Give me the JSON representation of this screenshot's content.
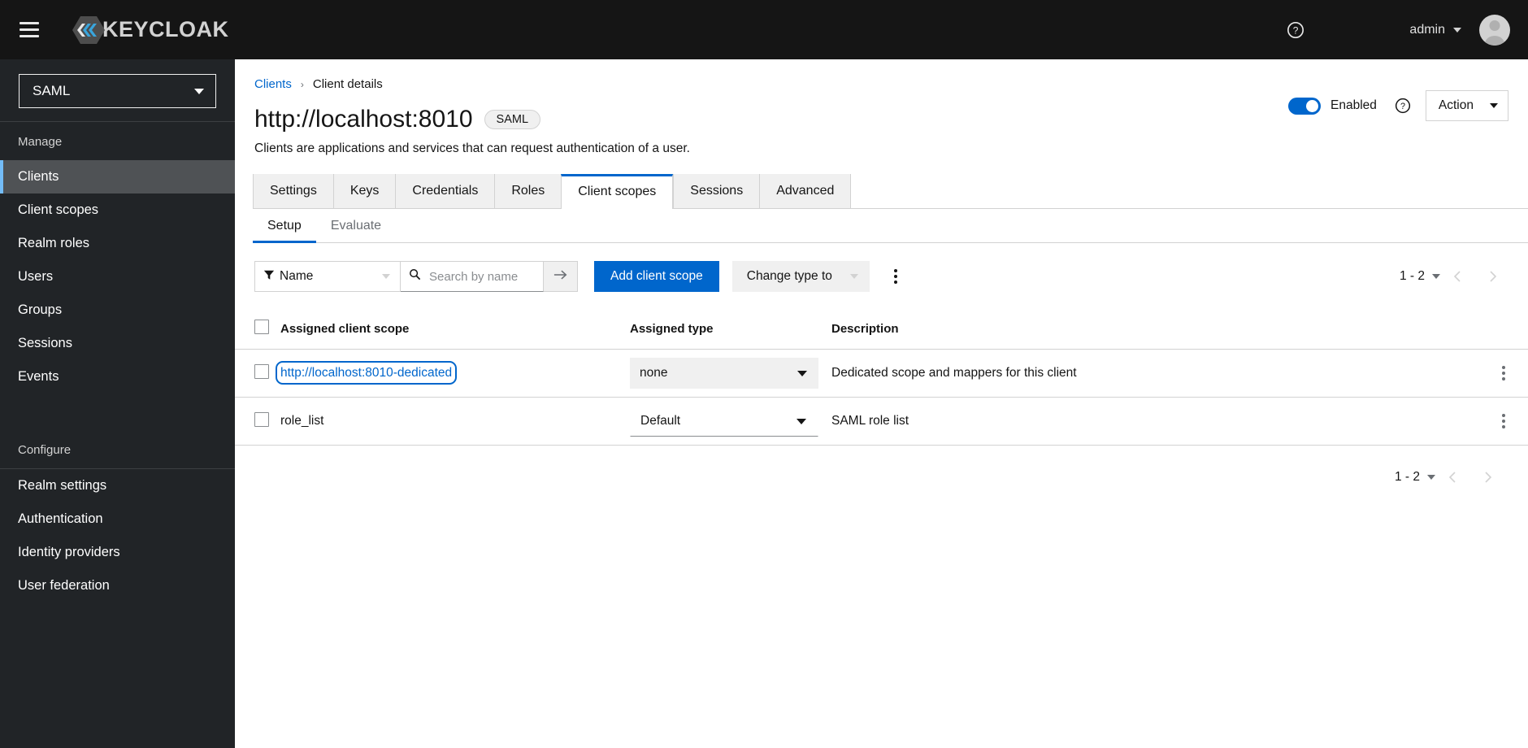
{
  "masthead": {
    "menu_icon": "hamburger-icon",
    "brand": "KEYCLOAK",
    "help_icon": "help-circle-icon",
    "username": "admin",
    "avatar_icon": "user-avatar-icon"
  },
  "sidebar": {
    "realm_selected": "SAML",
    "groups": [
      {
        "title": "Manage",
        "items": [
          {
            "label": "Clients",
            "active": true
          },
          {
            "label": "Client scopes",
            "active": false
          },
          {
            "label": "Realm roles",
            "active": false
          },
          {
            "label": "Users",
            "active": false
          },
          {
            "label": "Groups",
            "active": false
          },
          {
            "label": "Sessions",
            "active": false
          },
          {
            "label": "Events",
            "active": false
          }
        ]
      },
      {
        "title": "Configure",
        "items": [
          {
            "label": "Realm settings",
            "active": false
          },
          {
            "label": "Authentication",
            "active": false
          },
          {
            "label": "Identity providers",
            "active": false
          },
          {
            "label": "User federation",
            "active": false
          }
        ]
      }
    ]
  },
  "breadcrumb": {
    "parent": "Clients",
    "separator": "›",
    "current": "Client details"
  },
  "header": {
    "title": "http://localhost:8010",
    "badge": "SAML",
    "description": "Clients are applications and services that can request authentication of a user.",
    "enabled_label": "Enabled",
    "enabled_state": true,
    "help_icon": "help-circle-icon",
    "action_label": "Action"
  },
  "tabs": [
    {
      "label": "Settings",
      "active": false
    },
    {
      "label": "Keys",
      "active": false
    },
    {
      "label": "Credentials",
      "active": false
    },
    {
      "label": "Roles",
      "active": false
    },
    {
      "label": "Client scopes",
      "active": true
    },
    {
      "label": "Sessions",
      "active": false
    },
    {
      "label": "Advanced",
      "active": false
    }
  ],
  "subtabs": [
    {
      "label": "Setup",
      "active": true
    },
    {
      "label": "Evaluate",
      "active": false
    }
  ],
  "toolbar": {
    "filter_icon": "filter-icon",
    "filter_value": "Name",
    "search_icon": "search-icon",
    "search_value": "",
    "search_placeholder": "Search by name",
    "search_go_icon": "arrow-right-icon",
    "add_scope_label": "Add client scope",
    "change_type_label": "Change type to",
    "overflow_icon": "kebab-menu-icon"
  },
  "pagination": {
    "range": "1 - 2",
    "prev_icon": "chevron-left-icon",
    "next_icon": "chevron-right-icon"
  },
  "table": {
    "columns": [
      "Assigned client scope",
      "Assigned type",
      "Description"
    ],
    "rows": [
      {
        "scope": "http://localhost:8010-dedicated",
        "focused": true,
        "type": "none",
        "type_style": "filled",
        "description": "Dedicated scope and mappers for this client",
        "kebab_icon": "kebab-menu-icon"
      },
      {
        "scope": "role_list",
        "focused": false,
        "type": "Default",
        "type_style": "outlined",
        "description": "SAML role list",
        "kebab_icon": "kebab-menu-icon"
      }
    ]
  },
  "colors": {
    "brand_accent": "#39a5dc",
    "primary": "#0066cc",
    "masthead_bg": "#151515",
    "sidebar_bg": "#212427",
    "sidebar_active_bg": "#4f5255",
    "sidebar_active_bar": "#73bcf7",
    "link": "#0066cc",
    "border": "#d2d2d2",
    "muted": "#6a6e73"
  }
}
